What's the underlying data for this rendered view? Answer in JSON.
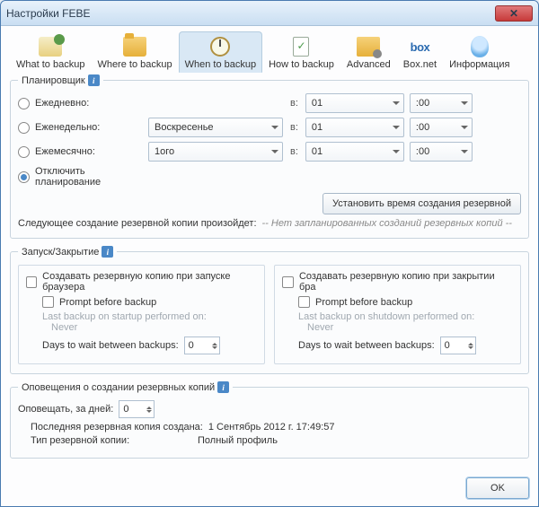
{
  "window": {
    "title": "Настройки FEBE"
  },
  "tabs": [
    {
      "label": "What to backup"
    },
    {
      "label": "Where to backup"
    },
    {
      "label": "When to backup"
    },
    {
      "label": "How to backup"
    },
    {
      "label": "Advanced"
    },
    {
      "label": "Box.net"
    },
    {
      "label": "Информация"
    }
  ],
  "scheduler": {
    "legend": "Планировщик",
    "rows": {
      "daily": {
        "label": "Ежедневно:",
        "at": "в:",
        "hour": "01",
        "min": ":00"
      },
      "weekly": {
        "label": "Еженедельно:",
        "day": "Воскресенье",
        "at": "в:",
        "hour": "01",
        "min": ":00"
      },
      "monthly": {
        "label": "Ежемесячно:",
        "dom": "1ого",
        "at": "в:",
        "hour": "01",
        "min": ":00"
      },
      "disable": {
        "label": "Отключить планирование"
      }
    },
    "set_time_btn": "Установить время создания резервной",
    "next_label": "Следующее создание резервной копии произойдет:",
    "next_value": "--  Нет запланированных созданий резервных копий  --"
  },
  "startstop": {
    "legend": "Запуск/Закрытие",
    "startup": {
      "chk": "Создавать резервную копию при запуске браузера",
      "prompt": "Prompt before backup",
      "last_label": "Last backup on startup performed on:",
      "last_value": "Never",
      "wait_label": "Days to wait between backups:",
      "wait_value": "0"
    },
    "shutdown": {
      "chk": "Создавать резервную копию при закрытии бра",
      "prompt": "Prompt before backup",
      "last_label": "Last backup on shutdown performed on:",
      "last_value": "Never",
      "wait_label": "Days to wait between backups:",
      "wait_value": "0"
    }
  },
  "alerts": {
    "legend": "Оповещения о создании резервных копий",
    "remind_label": "Оповещать, за дней:",
    "remind_value": "0",
    "last_label": "Последняя резервная копия создана:",
    "last_value": "1 Сентябрь 2012 г. 17:49:57",
    "type_label": "Тип резервной копии:",
    "type_value": "Полный профиль"
  },
  "footer": {
    "ok": "OK"
  }
}
